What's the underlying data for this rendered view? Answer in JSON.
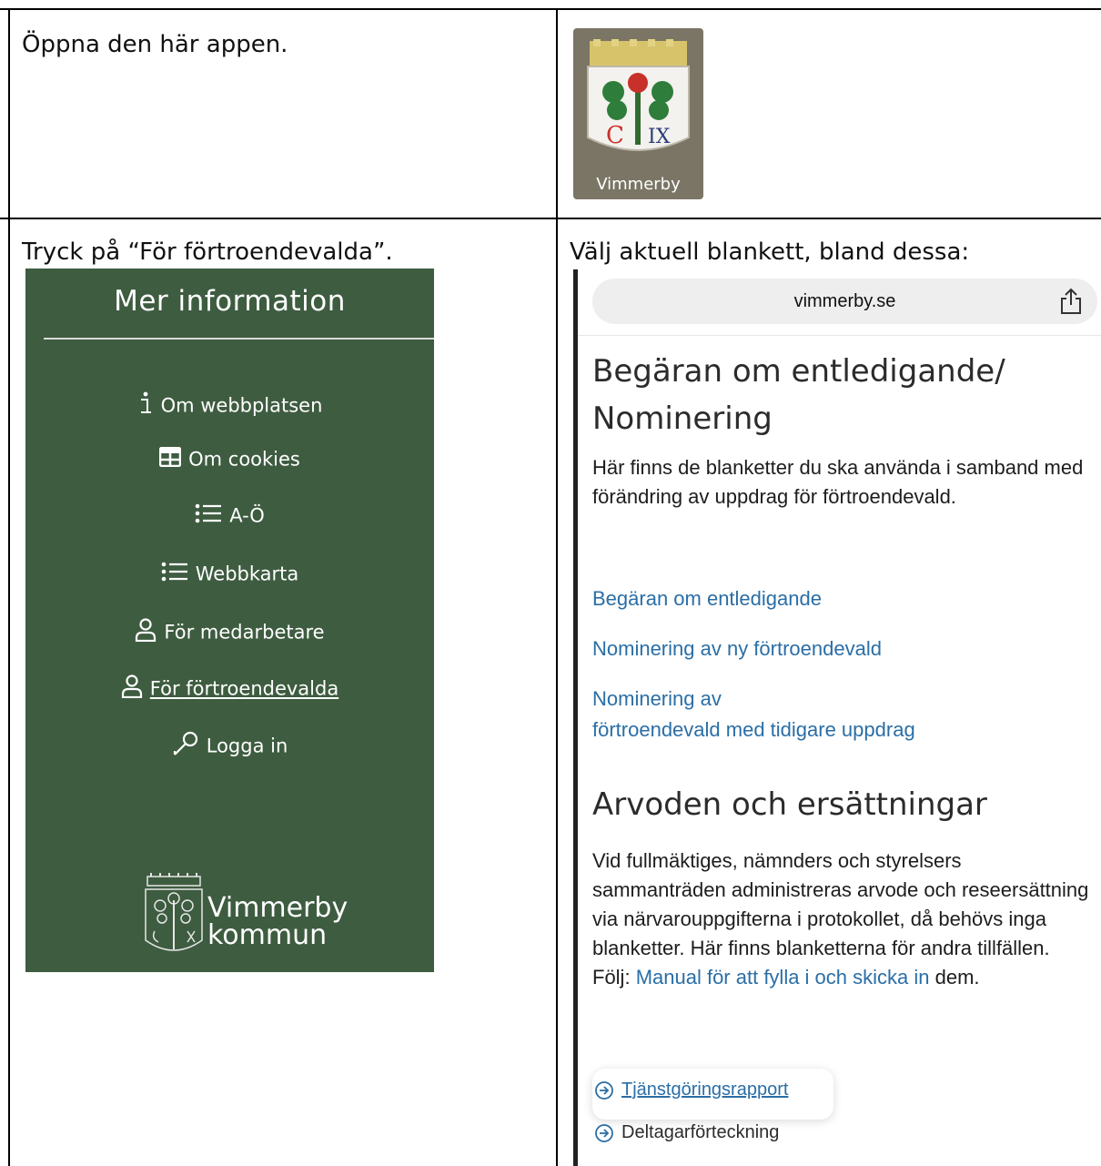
{
  "cells": {
    "step1": "Öppna den här appen.",
    "step2": "Tryck på “För förtroendevalda”.",
    "step3": "Välj aktuell blankett, bland dessa:"
  },
  "app_icon": {
    "label": "Vimmerby",
    "crest_text_left": "C",
    "crest_text_right": "IX"
  },
  "menu": {
    "title": "Mer information",
    "items": [
      {
        "label": "Om webbplatsen",
        "icon": "info-icon"
      },
      {
        "label": "Om cookies",
        "icon": "table-icon"
      },
      {
        "label": "A-Ö",
        "icon": "list-icon"
      },
      {
        "label": "Webbkarta",
        "icon": "list-icon"
      },
      {
        "label": "För medarbetare",
        "icon": "person-icon"
      },
      {
        "label": "För förtroendevalda",
        "icon": "person-icon"
      },
      {
        "label": "Logga in",
        "icon": "key-icon"
      }
    ],
    "logo_line1": "Vimmerby",
    "logo_line2": "kommun",
    "background": "#3e5c40"
  },
  "browser": {
    "url": "vimmerby.se",
    "heading1_line1": "Begäran om entledigande/",
    "heading1_line2": "Nominering",
    "intro": "Här finns de blanketter du ska använda i samband med förändring av uppdrag för förtroendevald.",
    "links": [
      "Begäran om entledigande",
      "Nominering av ny förtroendevald",
      "Nominering av",
      "förtroendevald med tidigare uppdrag"
    ],
    "heading2": "Arvoden och ersättningar",
    "body2": "Vid fullmäktiges, nämnders och styrelsers sammanträden administreras arvode och reseersättning via närvarouppgifterna i protokollet, då behövs inga blanketter. Här finns blanketterna för andra tillfällen. Följ:",
    "manual_link": "Manual för att fylla i och skicka in",
    "manual_tail": " dem.",
    "docs": [
      "Tjänstgöringsrapport",
      "Deltagarförteckning"
    ],
    "link_color": "#2a6ea6"
  }
}
